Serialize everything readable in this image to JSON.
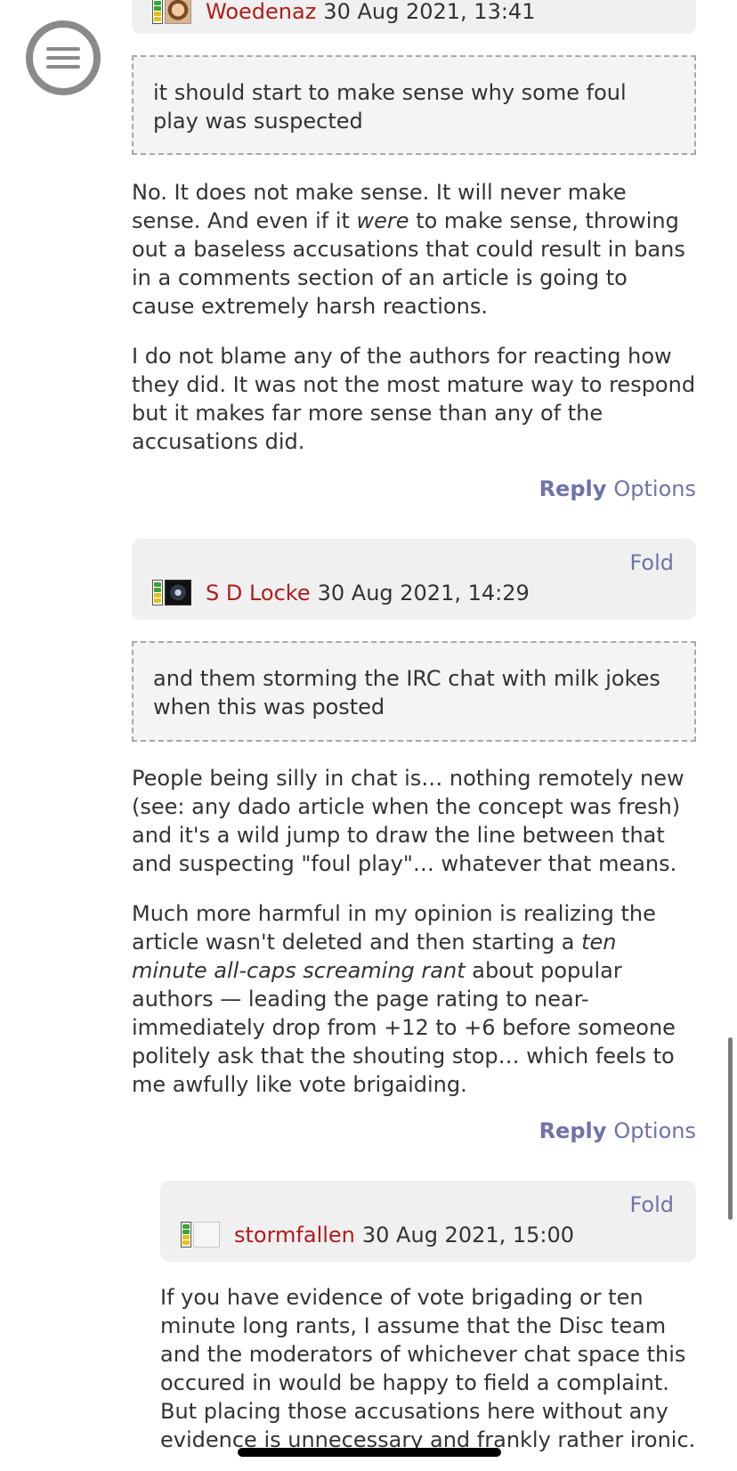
{
  "comments": [
    {
      "username": "Woedenaz",
      "timestamp": "30 Aug 2021, 13:41",
      "quote": "it should start to make sense why some foul play was suspected",
      "paragraphs": [
        {
          "before": "No. It does not make sense. It will never make sense. And even if it ",
          "em": "were",
          "after": " to make sense, throwing out a baseless accusations that could result in bans in a comments section of an article is going to cause extremely harsh reactions."
        },
        {
          "text": "I do not blame any of the authors for reacting how they did. It was not the most mature way to respond but it makes far more sense than any of the accusations did."
        }
      ],
      "reply_label": "Reply",
      "options_label": "Options"
    },
    {
      "fold_label": "Fold",
      "username": "S D Locke",
      "timestamp": "30 Aug 2021, 14:29",
      "quote": "and them storming the IRC chat with milk jokes when this was posted",
      "paragraphs": [
        {
          "text": "People being silly in chat is… nothing remotely new (see: any dado article when the concept was fresh) and it's a wild jump to draw the line between that and suspecting \"foul play\"… whatever that means."
        },
        {
          "before": "Much more harmful in my opinion is realizing the article wasn't deleted and then starting a ",
          "em": "ten minute all-caps screaming rant",
          "after": " about popular authors — leading the page rating to near-immediately drop from +12 to +6 before someone politely ask that the shouting stop… which feels to me awfully like vote brigaiding."
        }
      ],
      "reply_label": "Reply",
      "options_label": "Options"
    },
    {
      "fold_label": "Fold",
      "username": "stormfallen",
      "timestamp": "30 Aug 2021, 15:00",
      "paragraphs": [
        {
          "text": "If you have evidence of vote brigading or ten minute long rants, I assume that the Disc team and the moderators of whichever chat space this occured in would be happy to field a complaint. But placing those accusations here without any evidence is unnecessary and frankly rather ironic."
        }
      ]
    }
  ],
  "icons": {
    "menu": "hamburger-menu-icon",
    "rank": "rank-meter-icon",
    "avatar": "user-avatar"
  },
  "colors": {
    "username": "#b01c1c",
    "link": "#6f73a6",
    "header_bg": "#f0f0f0",
    "quote_bg": "#f4f4f4",
    "text": "#333333",
    "rank_green": "#3aa335",
    "rank_yellow": "#e2c21a"
  }
}
